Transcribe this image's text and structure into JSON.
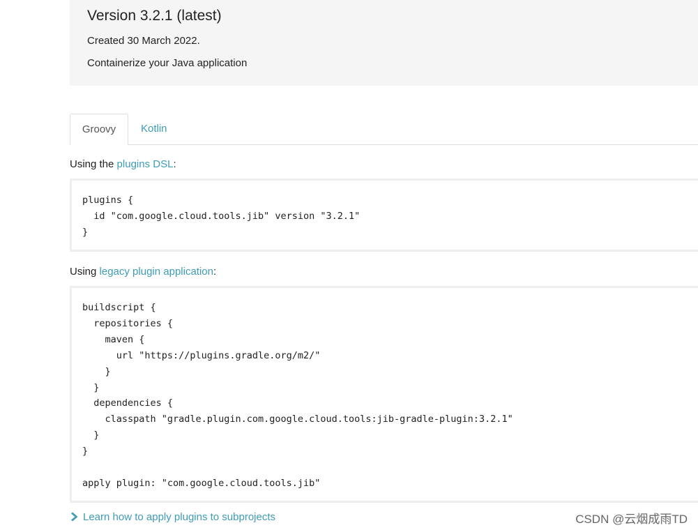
{
  "header": {
    "version_title": "Version 3.2.1 (latest)",
    "created": "Created 30 March 2022.",
    "description": "Containerize your Java application"
  },
  "tabs": [
    {
      "label": "Groovy",
      "active": true
    },
    {
      "label": "Kotlin",
      "active": false
    }
  ],
  "dsl_section": {
    "prefix": "Using the ",
    "link_text": "plugins DSL",
    "suffix": ":",
    "code": "plugins {\n  id \"com.google.cloud.tools.jib\" version \"3.2.1\"\n}"
  },
  "legacy_section": {
    "prefix": "Using ",
    "link_text": "legacy plugin application",
    "suffix": ":",
    "code": "buildscript {\n  repositories {\n    maven {\n      url \"https://plugins.gradle.org/m2/\"\n    }\n  }\n  dependencies {\n    classpath \"gradle.plugin.com.google.cloud.tools:jib-gradle-plugin:3.2.1\"\n  }\n}\n\napply plugin: \"com.google.cloud.tools.jib\""
  },
  "learn_link": {
    "text": "Learn how to apply plugins to subprojects",
    "icon": "chevron-right-icon"
  },
  "watermark": "CSDN @云烟成雨TD",
  "colors": {
    "link": "#3d9cb6",
    "header_bg": "#f5f5f5",
    "code_border": "#eeeeee"
  }
}
